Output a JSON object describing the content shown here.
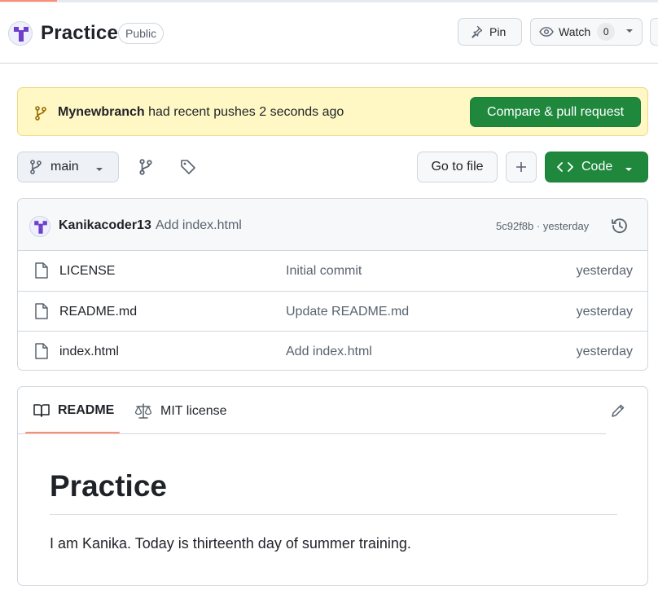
{
  "header": {
    "repo_name": "Practice",
    "visibility": "Public",
    "pin_label": "Pin",
    "watch_label": "Watch",
    "watch_count": "0"
  },
  "banner": {
    "branch": "Mynewbranch",
    "message": " had recent pushes 2 seconds ago",
    "compare_label": "Compare & pull request"
  },
  "toolbar": {
    "branch": "main",
    "goto_label": "Go to file",
    "add_label": "+",
    "code_label": "Code"
  },
  "latest_commit": {
    "author": "Kanikacoder13",
    "message": "Add index.html",
    "meta": "5c92f8b · yesterday"
  },
  "files": [
    {
      "name": "LICENSE",
      "commit": "Initial commit",
      "date": "yesterday"
    },
    {
      "name": "README.md",
      "commit": "Update README.md",
      "date": "yesterday"
    },
    {
      "name": "index.html",
      "commit": "Add index.html",
      "date": "yesterday"
    }
  ],
  "readme": {
    "tab_readme": "README",
    "tab_license": "MIT license",
    "heading": "Practice",
    "body": "I am Kanika. Today is thirteenth day of summer training."
  },
  "colors": {
    "primary_green": "#1f883d",
    "banner_bg": "#fff8c5",
    "tab_accent": "#fd8c73",
    "avatar_purple": "#6e40c9"
  },
  "icons": [
    "pin-icon",
    "eye-icon",
    "git-branch-icon",
    "tag-icon",
    "code-icon",
    "history-icon",
    "file-icon",
    "book-icon",
    "law-icon",
    "pencil-icon"
  ]
}
